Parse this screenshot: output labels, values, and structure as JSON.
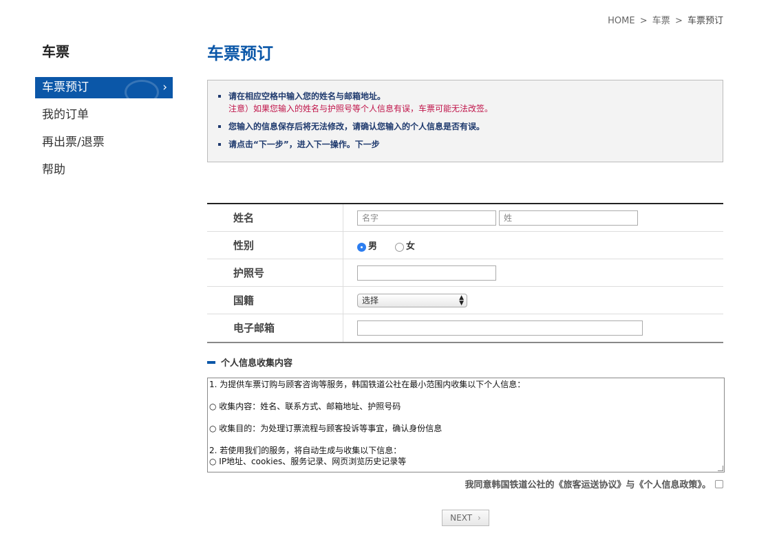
{
  "breadcrumb": {
    "home": "HOME",
    "sep": ">",
    "level1": "车票",
    "current": "车票预订"
  },
  "sidebar": {
    "title": "车票",
    "items": [
      {
        "label": "车票预订",
        "active": true
      },
      {
        "label": "我的订单"
      },
      {
        "label": "再出票/退票"
      },
      {
        "label": "帮助"
      }
    ]
  },
  "page_title": "车票预订",
  "notice": {
    "item1": "请在相应空格中输入您的姓名与邮箱地址。",
    "warning": "注意）如果您输入的姓名与护照号等个人信息有误，车票可能无法改签。",
    "item2": "您输入的信息保存后将无法修改，请确认您输入的个人信息是否有误。",
    "item3": "请点击“下一步”，进入下一操作。下一步"
  },
  "form": {
    "name_label": "姓名",
    "first_name_placeholder": "名字",
    "last_name_placeholder": "姓",
    "gender_label": "性别",
    "male": "男",
    "female": "女",
    "gender_selected": "男",
    "passport_label": "护照号",
    "nationality_label": "国籍",
    "nationality_value": "选择",
    "email_label": "电子邮箱"
  },
  "privacy": {
    "heading": "个人信息收集内容",
    "lines": [
      "1. 为提供车票订购与顾客咨询等服务，韩国铁道公社在最小范围内收集以下个人信息：",
      "",
      "○ 收集内容：姓名、联系方式、邮箱地址、护照号码",
      "",
      "○ 收集目的：为处理订票流程与顾客投诉等事宜，确认身份信息",
      "",
      "2. 若使用我们的服务，将自动生成与收集以下信息：",
      "○ IP地址、cookies、服务记录、网页浏览历史记录等"
    ],
    "agree_text": "我同意韩国铁道公社的《旅客运送协议》与《个人信息政策》。"
  },
  "next_button": "NEXT",
  "colors": {
    "accent": "#0b57a8",
    "warning": "#c0144a",
    "notice_text": "#1f3a6e"
  }
}
